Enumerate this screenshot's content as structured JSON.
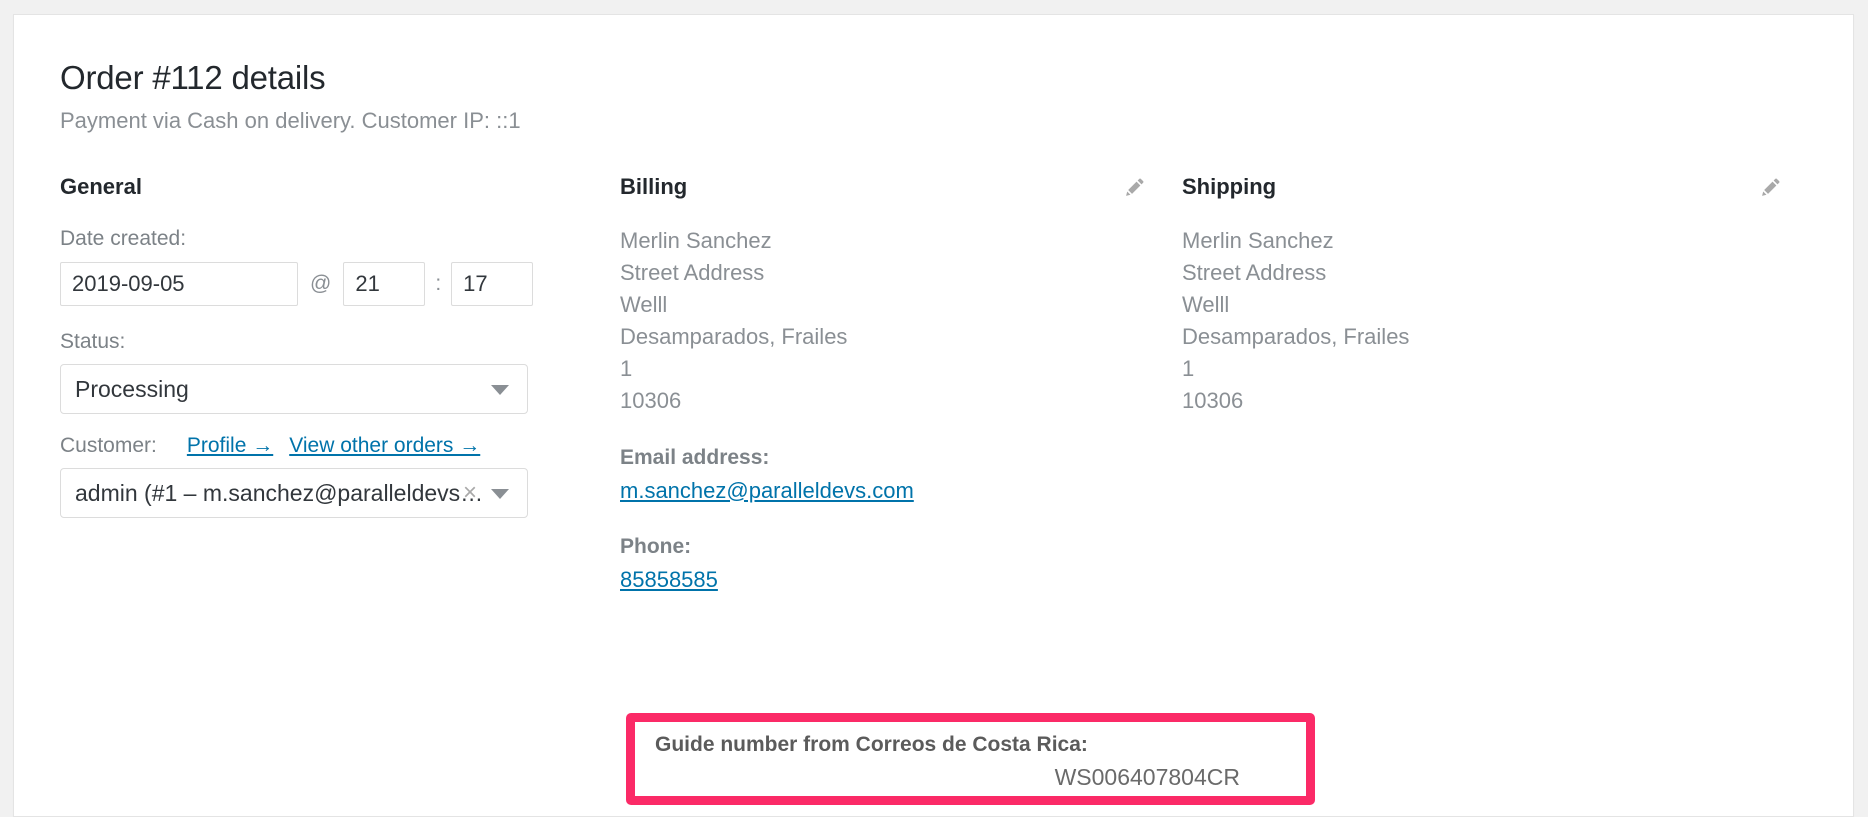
{
  "page": {
    "title": "Order #112 details",
    "subtitle": "Payment via Cash on delivery. Customer IP: ::1"
  },
  "general": {
    "heading": "General",
    "date_label": "Date created:",
    "date_value": "2019-09-05",
    "at_separator": "@",
    "hour_value": "21",
    "time_separator": ":",
    "minute_value": "17",
    "status_label": "Status:",
    "status_value": "Processing",
    "customer_label": "Customer:",
    "profile_link": "Profile →",
    "other_orders_link": "View other orders →",
    "customer_value": "admin (#1 – m.sanchez@paralleldevs…",
    "clear_icon": "×"
  },
  "billing": {
    "heading": "Billing",
    "edit_icon": "pencil-icon",
    "address_lines": [
      "Merlin Sanchez",
      "Street Address",
      "Welll",
      "Desamparados, Frailes",
      "1",
      "10306"
    ],
    "email_label": "Email address:",
    "email_value": "m.sanchez@paralleldevs.com",
    "phone_label": "Phone:",
    "phone_value": "85858585"
  },
  "shipping": {
    "heading": "Shipping",
    "edit_icon": "pencil-icon",
    "address_lines": [
      "Merlin Sanchez",
      "Street Address",
      "Welll",
      "Desamparados, Frailes",
      "1",
      "10306"
    ]
  },
  "guide": {
    "title": "Guide number from Correos de Costa Rica:",
    "value": "WS006407804CR",
    "highlight_color": "#fb2a67"
  },
  "colors": {
    "link": "#0073aa",
    "muted": "#8a8f94",
    "heading": "#23282d",
    "page_background": "#f1f1f1"
  }
}
